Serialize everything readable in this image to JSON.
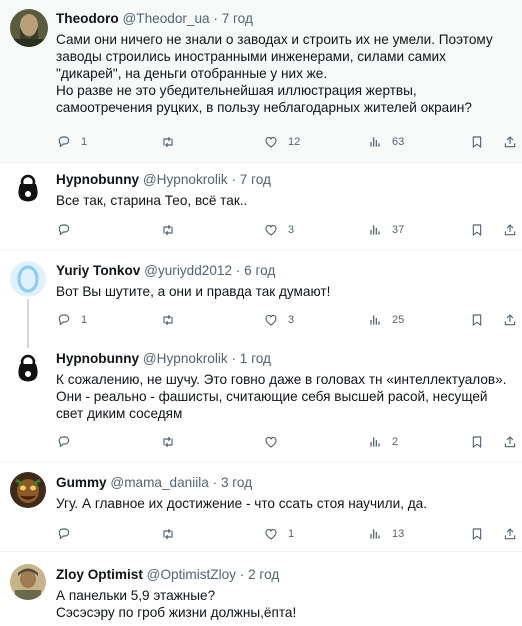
{
  "tweets": [
    {
      "name": "Theodoro",
      "handle": "@Theodor_ua",
      "time": "7 год",
      "text": "Сами они ничего не знали о заводах и строить их не умели. Поэтому заводы строились иностранными инженерами, силами самих \"дикарей\", на деньги отобранные у них же.\nНо разве не это убедительнейшая иллюстрация жертвы, самоотречения руцких, в пользу неблагодарных жителей окраин?",
      "replies": "1",
      "retweets": "",
      "likes": "12",
      "views": "63"
    },
    {
      "name": "Hypnobunny",
      "handle": "@Hypnokrolik",
      "time": "7 год",
      "text": "Все так, старина Тео, всё так..",
      "replies": "",
      "retweets": "",
      "likes": "3",
      "views": "37"
    },
    {
      "name": "Yuriy Tonkov",
      "handle": "@yuriydd2012",
      "time": "6 год",
      "text": "Вот Вы шутите, а они и правда так думают!",
      "replies": "1",
      "retweets": "",
      "likes": "3",
      "views": "25"
    },
    {
      "name": "Hypnobunny",
      "handle": "@Hypnokrolik",
      "time": "1 год",
      "text": "К сожалению, не шучу. Это говно даже в головах тн «интеллектуалов». Они - реально - фашисты, считающие себя высшей расой, несущей свет диким соседям",
      "replies": "",
      "retweets": "",
      "likes": "",
      "views": "2"
    },
    {
      "name": "Gummy",
      "handle": "@mama_daniila",
      "time": "3 год",
      "text": "Угу. А главное их достижение - что ссать стоя научили, да.",
      "replies": "",
      "retweets": "",
      "likes": "1",
      "views": "13"
    },
    {
      "name": "Zloy Optimist",
      "handle": "@OptimistZloy",
      "time": "2 год",
      "text": "А панельки 5,9 этажные?\nСэсэсэру по гроб жизни должны,ёпта!",
      "replies": "",
      "retweets": "",
      "likes": "",
      "views": ""
    }
  ],
  "colors": {
    "text": "#0f1419",
    "secondary": "#536471",
    "highlight_bg": "#f7f9f9",
    "divider": "#eff3f4",
    "thread_line": "#cfd9de"
  }
}
